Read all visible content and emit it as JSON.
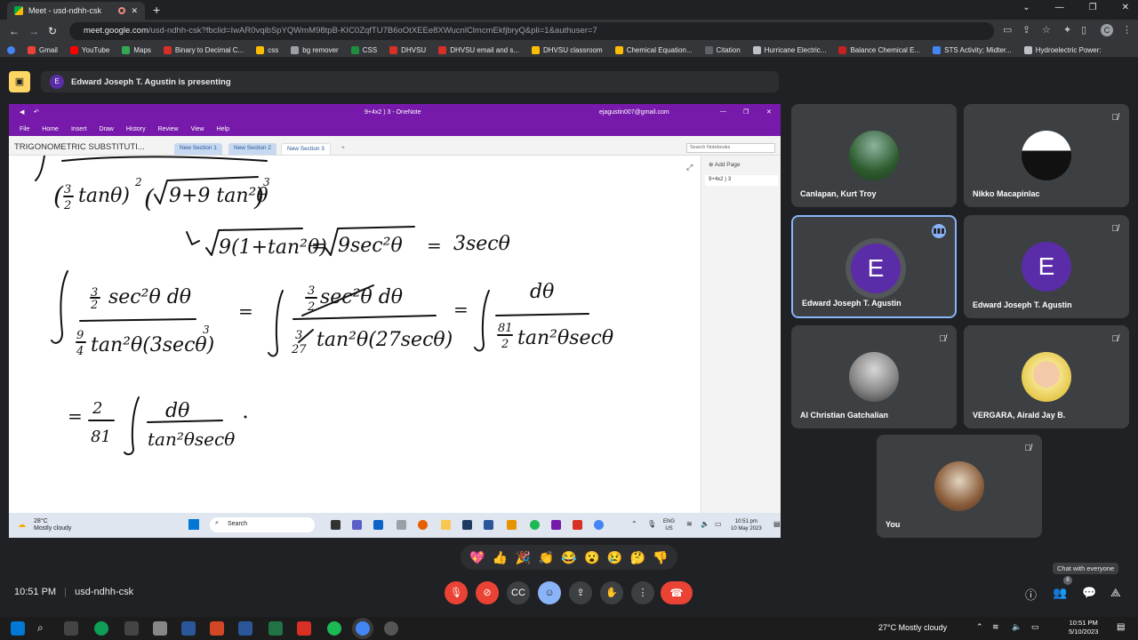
{
  "browser": {
    "tab_title": "Meet - usd-ndhh-csk",
    "url_host": "meet.google.com",
    "url_path": "/usd-ndhh-csk?fbclid=IwAR0vqibSpYQWmM98tpB-KIC0ZqfTU7B6oOtXEEe8XWucnlClmcmEkfjbryQ&pli=1&authuser=7",
    "profile_initial": "C",
    "bookmarks": [
      {
        "label": "Gmail",
        "color": "#ea4335"
      },
      {
        "label": "YouTube",
        "color": "#ff0000"
      },
      {
        "label": "Maps",
        "color": "#34a853"
      },
      {
        "label": "Binary to Decimal C...",
        "color": "#d93025"
      },
      {
        "label": "css",
        "color": "#fbbc04"
      },
      {
        "label": "bg remover",
        "color": "#9aa0a6"
      },
      {
        "label": "CSS",
        "color": "#1e8e3e"
      },
      {
        "label": "DHVSU",
        "color": "#d93025"
      },
      {
        "label": "DHVSU email and s...",
        "color": "#d93025"
      },
      {
        "label": "DHVSU classroom",
        "color": "#fbbc04"
      },
      {
        "label": "Chemical Equation...",
        "color": "#fbbc04"
      },
      {
        "label": "Citation",
        "color": "#5f6368"
      },
      {
        "label": "Hurricane Electric...",
        "color": "#bdc1c6"
      },
      {
        "label": "Balance Chemical E...",
        "color": "#c5221f"
      },
      {
        "label": "STS Activity; Midter...",
        "color": "#4285f4"
      },
      {
        "label": "Hydroelectric Power:",
        "color": "#bdc1c6"
      }
    ]
  },
  "meet": {
    "presenting_initial": "E",
    "presenting_text": "Edward Joseph T. Agustin is presenting",
    "clock": "10:51 PM",
    "meeting_code": "usd-ndhh-csk",
    "chat_tooltip": "Chat with everyone",
    "people_count": "8",
    "reactions": [
      "💖",
      "👍",
      "🎉",
      "👏",
      "😂",
      "😮",
      "😢",
      "🤔",
      "👎"
    ],
    "participants": [
      {
        "name": "Canlapan, Kurt Troy"
      },
      {
        "name": "Nikko Macapinlac"
      },
      {
        "name": "Edward Joseph T. Agustin",
        "initial": "E"
      },
      {
        "name": "Edward Joseph T. Agustin",
        "initial": "E"
      },
      {
        "name": "Al Christian Gatchalian"
      },
      {
        "name": "VERGARA, Airald Jay B."
      },
      {
        "name": "You"
      }
    ]
  },
  "onenote": {
    "window_title": "9+4x2 ) 3  -  OneNote",
    "account": "ejagustin007@gmail.com",
    "menu": [
      "File",
      "Home",
      "Insert",
      "Draw",
      "History",
      "Review",
      "View",
      "Help"
    ],
    "notebook": "TRIGONOMETRIC SUBSTITUTI...",
    "sections": [
      "New Section 1",
      "New Section 2",
      "New Section 3"
    ],
    "add_section": "+",
    "search_placeholder": "Search Notebooks",
    "add_page": "Add Page",
    "page_title": "9+4x2 ) 3",
    "handwriting": {
      "line1": "(3/2 tanθ)² (√(9+9tan²θ))³",
      "line2": "↳ √9(1+tan²θ) = √9sec²θ = 3secθ",
      "line3": "∫ 3/2 sec²θ dθ / 9/4 tan²θ(3secθ)³ = ∫ 3/2 sec²θ dθ / 9/4 tan²θ(27sec³θ) = ∫ dθ / 81/2 tan²θ secθ",
      "line4": "= 2/81 ∫ dθ / tan²θ secθ"
    }
  },
  "inner_taskbar": {
    "temp": "28°C",
    "weather": "Mostly cloudy",
    "search": "Search",
    "lang1": "ENG",
    "lang2": "US",
    "time": "10:51 pm",
    "date": "10 May 2023"
  },
  "taskbar": {
    "weather": "27°C  Mostly cloudy",
    "time": "10:51 PM",
    "date": "5/10/2023"
  }
}
